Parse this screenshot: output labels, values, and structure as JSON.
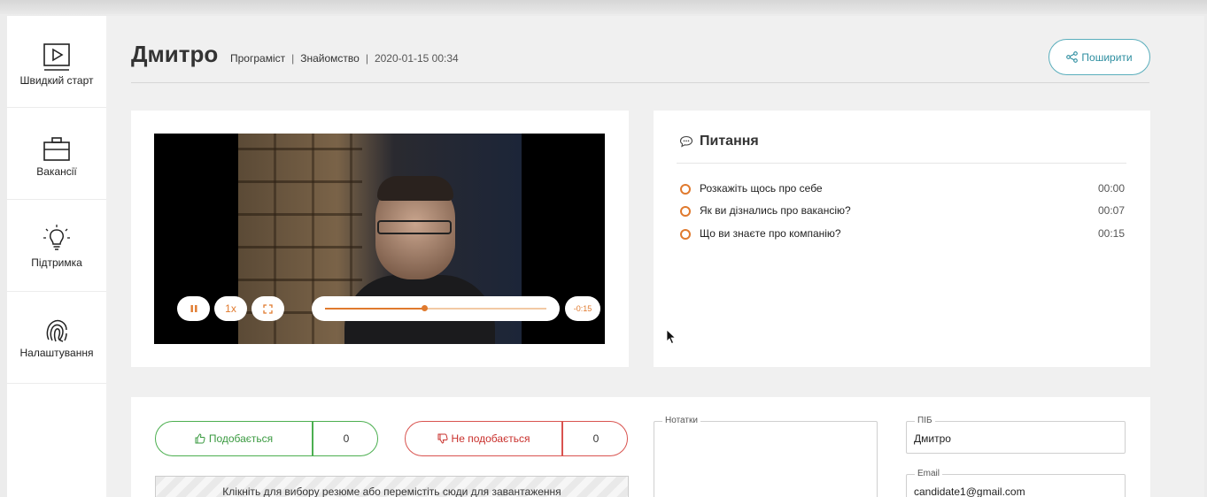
{
  "sidebar": {
    "items": [
      {
        "label": "Швидкий старт",
        "icon": "play-screen-icon"
      },
      {
        "label": "Вакансії",
        "icon": "briefcase-icon"
      },
      {
        "label": "Підтримка",
        "icon": "lightbulb-icon"
      },
      {
        "label": "Налаштування",
        "icon": "fingerprint-icon"
      }
    ]
  },
  "header": {
    "name": "Дмитро",
    "position": "Програміст",
    "stage": "Знайомство",
    "datetime": "2020-01-15 00:34",
    "share_label": "Поширити"
  },
  "player": {
    "speed": "1x",
    "remaining": "-0:15",
    "progress": 0.45,
    "state": "playing"
  },
  "questions": {
    "title": "Питання",
    "items": [
      {
        "text": "Розкажіть щось про себе",
        "time": "00:00"
      },
      {
        "text": "Як ви дізнались про вакансію?",
        "time": "00:07"
      },
      {
        "text": "Що ви знаєте про компанію?",
        "time": "00:15"
      }
    ]
  },
  "feedback": {
    "like_label": "Подобається",
    "like_count": "0",
    "dislike_label": "Не подобається",
    "dislike_count": "0",
    "upload_text": "Клікніть для вибору резюме або перемістіть сюди для завантаження"
  },
  "form": {
    "notes_label": "Нотатки",
    "notes_value": "",
    "fio_label": "ПІБ",
    "fio_value": "Дмитро",
    "email_label": "Email",
    "email_value": "candidate1@gmail.com"
  },
  "colors": {
    "accent_teal": "#2d8ea0",
    "accent_orange": "#e07a2e",
    "like_green": "#4caf50",
    "dislike_red": "#d9534f"
  }
}
